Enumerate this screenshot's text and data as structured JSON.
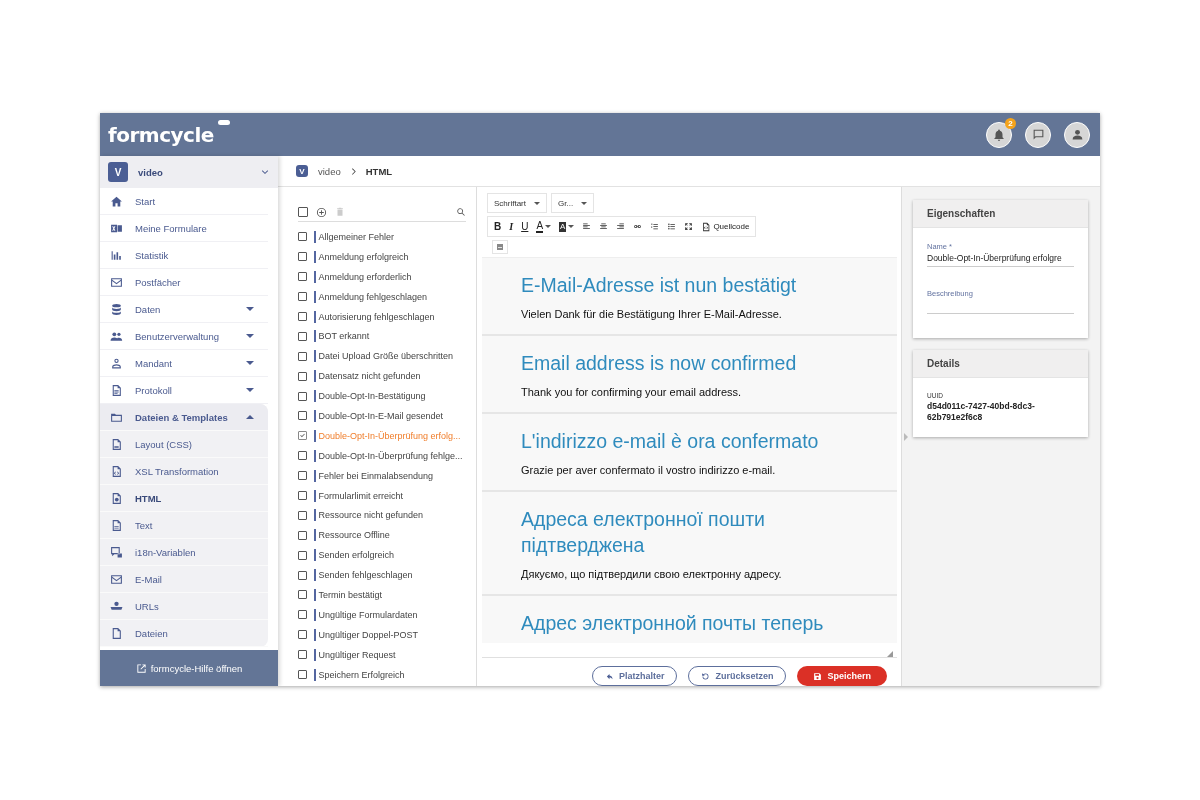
{
  "header": {
    "logo": "formcycle",
    "notifications": {
      "count": "2"
    }
  },
  "sidebar": {
    "client": {
      "initial": "V",
      "name": "video"
    },
    "items": [
      {
        "label": "Start",
        "selected": false
      },
      {
        "label": "Meine Formulare",
        "selected": false
      },
      {
        "label": "Statistik",
        "selected": false
      },
      {
        "label": "Postfächer",
        "selected": false
      },
      {
        "label": "Daten",
        "selected": false,
        "expanded": false
      },
      {
        "label": "Benutzerverwaltung",
        "selected": false,
        "expanded": false
      },
      {
        "label": "Mandant",
        "selected": false,
        "expanded": false
      },
      {
        "label": "Protokoll",
        "selected": false,
        "expanded": false
      },
      {
        "label": "Dateien & Templates",
        "selected": false,
        "expanded": true,
        "children": [
          {
            "label": "Layout (CSS)",
            "selected": false
          },
          {
            "label": "XSL Transformation",
            "selected": false
          },
          {
            "label": "HTML",
            "selected": true
          },
          {
            "label": "Text",
            "selected": false
          },
          {
            "label": "i18n-Variablen",
            "selected": false
          },
          {
            "label": "E-Mail",
            "selected": false
          },
          {
            "label": "URLs",
            "selected": false
          },
          {
            "label": "Dateien",
            "selected": false
          }
        ]
      }
    ],
    "help_link": "formcycle-Hilfe öffnen"
  },
  "breadcrumb": {
    "initial": "V",
    "items": [
      "video",
      "HTML"
    ]
  },
  "template_toolbar": {
    "select_all_checked": false
  },
  "templates": [
    {
      "label": "Allgemeiner Fehler",
      "selected": false
    },
    {
      "label": "Anmeldung erfolgreich",
      "selected": false
    },
    {
      "label": "Anmeldung erforderlich",
      "selected": false
    },
    {
      "label": "Anmeldung fehlgeschlagen",
      "selected": false
    },
    {
      "label": "Autorisierung fehlgeschlagen",
      "selected": false
    },
    {
      "label": "BOT erkannt",
      "selected": false
    },
    {
      "label": "Datei Upload Größe überschritten",
      "selected": false
    },
    {
      "label": "Datensatz nicht gefunden",
      "selected": false
    },
    {
      "label": "Double-Opt-In-Bestätigung",
      "selected": false
    },
    {
      "label": "Double-Opt-In-E-Mail gesendet",
      "selected": false
    },
    {
      "label": "Double-Opt-In-Überprüfung erfolg...",
      "selected": true
    },
    {
      "label": "Double-Opt-In-Überprüfung fehlge...",
      "selected": false
    },
    {
      "label": "Fehler bei Einmalabsendung",
      "selected": false
    },
    {
      "label": "Formularlimit erreicht",
      "selected": false
    },
    {
      "label": "Ressource nicht gefunden",
      "selected": false
    },
    {
      "label": "Ressource Offline",
      "selected": false
    },
    {
      "label": "Senden erfolgreich",
      "selected": false
    },
    {
      "label": "Senden fehlgeschlagen",
      "selected": false
    },
    {
      "label": "Termin bestätigt",
      "selected": false
    },
    {
      "label": "Ungültige Formulardaten",
      "selected": false
    },
    {
      "label": "Ungültiger Doppel-POST",
      "selected": false
    },
    {
      "label": "Ungültiger Request",
      "selected": false
    },
    {
      "label": "Speichern Erfolgreich",
      "selected": false
    }
  ],
  "editor": {
    "dropdowns": [
      "Schriftart",
      "Gr..."
    ],
    "toolbar": [
      {
        "kind": "bold",
        "label": "B"
      },
      {
        "kind": "italic",
        "label": "I"
      },
      {
        "kind": "underline",
        "label": "U"
      },
      {
        "kind": "forecolor",
        "label": "A"
      },
      {
        "kind": "backcolor",
        "label": "A"
      },
      {
        "kind": "align-left"
      },
      {
        "kind": "align-center"
      },
      {
        "kind": "align-right"
      },
      {
        "kind": "link"
      },
      {
        "kind": "ordered-list"
      },
      {
        "kind": "bullet-list"
      },
      {
        "kind": "fullscreen"
      },
      {
        "kind": "source",
        "label": "Quellcode"
      }
    ],
    "sections": [
      {
        "heading": "E-Mail-Adresse ist nun bestätigt",
        "text": "Vielen Dank für die Bestätigung Ihrer E-Mail-Adresse."
      },
      {
        "heading": "Email address is now confirmed",
        "text": "Thank you for confirming your email address."
      },
      {
        "heading": "L'indirizzo e-mail è ora confermato",
        "text": "Grazie per aver confermato il vostro indirizzo e-mail."
      },
      {
        "heading": "Адреса електронної пошти підтверджена",
        "text": "Дякуємо, що підтвердили свою електронну адресу."
      },
      {
        "heading": "Адрес электронной почты теперь"
      }
    ],
    "buttons": [
      {
        "kind": "placeholder",
        "label": "Platzhalter"
      },
      {
        "kind": "reset",
        "label": "Zurücksetzen"
      },
      {
        "kind": "save",
        "label": "Speichern"
      }
    ]
  },
  "properties": {
    "title": "Eigenschaften",
    "name_label": "Name *",
    "name_value": "Double-Opt-In-Überprüfung erfolgre",
    "description_label": "Beschreibung"
  },
  "details": {
    "title": "Details",
    "uuid_label": "UUID",
    "uuid": "d54d011c-7427-40bd-8dc3-62b791e2f6c8"
  }
}
